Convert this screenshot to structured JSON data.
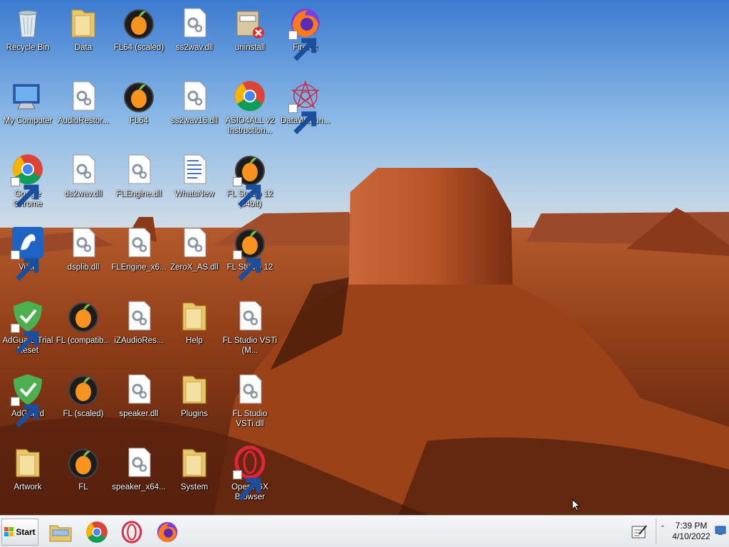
{
  "desktop": {
    "icons": [
      {
        "label": "Recycle Bin",
        "icon": "recycle-bin-icon",
        "shortcut": false
      },
      {
        "label": "Data",
        "icon": "folder-icon",
        "shortcut": false
      },
      {
        "label": "FL64 (scaled)",
        "icon": "fl-studio-icon",
        "shortcut": false
      },
      {
        "label": "ss2wav.dll",
        "icon": "dll-file-icon",
        "shortcut": false
      },
      {
        "label": "uninstall",
        "icon": "nsis-uninstall-icon",
        "shortcut": false
      },
      {
        "label": "Firefox",
        "icon": "firefox-icon",
        "shortcut": true
      },
      {
        "label": "My Computer",
        "icon": "computer-icon",
        "shortcut": false
      },
      {
        "label": "AudioRestor...",
        "icon": "dll-file-icon",
        "shortcut": false
      },
      {
        "label": "FL64",
        "icon": "fl-studio-icon",
        "shortcut": false
      },
      {
        "label": "ss2wav16.dll",
        "icon": "dll-file-icon",
        "shortcut": false
      },
      {
        "label": "ASIO4ALL v2 Instruction...",
        "icon": "chrome-icon",
        "shortcut": false
      },
      {
        "label": "DataWagon...",
        "icon": "datawagon-icon",
        "shortcut": true
      },
      {
        "label": "Google Chrome",
        "icon": "chrome-icon",
        "shortcut": true
      },
      {
        "label": "ds2wav.dll",
        "icon": "dll-file-icon",
        "shortcut": false
      },
      {
        "label": "FLEngine.dll",
        "icon": "dll-file-icon",
        "shortcut": false
      },
      {
        "label": "WhatsNew",
        "icon": "document-icon",
        "shortcut": false
      },
      {
        "label": "FL Studio 12 (64bit)",
        "icon": "fl-studio-icon",
        "shortcut": true
      },
      {
        "label": "Vuze",
        "icon": "vuze-icon",
        "shortcut": true
      },
      {
        "label": "dsplib.dll",
        "icon": "dll-file-icon",
        "shortcut": false
      },
      {
        "label": "FLEngine_x6...",
        "icon": "dll-file-icon",
        "shortcut": false
      },
      {
        "label": "ZeroX_AS.dll",
        "icon": "dll-file-icon",
        "shortcut": false
      },
      {
        "label": "FL Studio 12",
        "icon": "fl-studio-icon",
        "shortcut": true
      },
      {
        "label": "AdGuard Trial Reset",
        "icon": "adguard-icon",
        "shortcut": true
      },
      {
        "label": "FL (compatib...",
        "icon": "fl-studio-icon",
        "shortcut": false
      },
      {
        "label": "iZAudioRes...",
        "icon": "dll-file-icon",
        "shortcut": false
      },
      {
        "label": "Help",
        "icon": "folder-icon",
        "shortcut": false
      },
      {
        "label": "FL Studio VSTi (M...",
        "icon": "dll-file-icon",
        "shortcut": false
      },
      {
        "label": "AdGuard",
        "icon": "adguard-icon",
        "shortcut": true
      },
      {
        "label": "FL (scaled)",
        "icon": "fl-studio-icon",
        "shortcut": false
      },
      {
        "label": "speaker.dll",
        "icon": "dll-file-icon",
        "shortcut": false
      },
      {
        "label": "Plugins",
        "icon": "folder-icon",
        "shortcut": false
      },
      {
        "label": "FL Studio VSTi.dll",
        "icon": "dll-file-icon",
        "shortcut": false
      },
      {
        "label": "Artwork",
        "icon": "folder-icon",
        "shortcut": false
      },
      {
        "label": "FL",
        "icon": "fl-studio-icon",
        "shortcut": false
      },
      {
        "label": "speaker_x64...",
        "icon": "dll-file-icon",
        "shortcut": false
      },
      {
        "label": "System",
        "icon": "folder-icon",
        "shortcut": false
      },
      {
        "label": "Opera GX Browser",
        "icon": "opera-gx-icon",
        "shortcut": true
      }
    ]
  },
  "taskbar": {
    "start_label": "Start",
    "pinned": [
      {
        "name": "file-explorer-icon"
      },
      {
        "name": "chrome-icon"
      },
      {
        "name": "opera-icon"
      },
      {
        "name": "firefox-icon"
      }
    ],
    "tray": {
      "notes_icon": "notepad-tray-icon",
      "overflow_glyph": "˄",
      "time": "7:39 PM",
      "date": "4/10/2022"
    }
  }
}
